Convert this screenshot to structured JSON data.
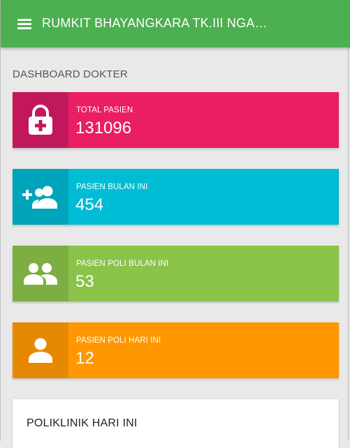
{
  "app": {
    "title": "RUMKIT BHAYANGKARA TK.III NGANJ..."
  },
  "dashboard": {
    "title": "DASHBOARD DOKTER"
  },
  "cards": [
    {
      "label": "TOTAL PASIEN",
      "value": "131096",
      "icon": "lock-plus-icon",
      "color": "#e91e63"
    },
    {
      "label": "PASIEN BULAN INI",
      "value": "454",
      "icon": "group-add-icon",
      "color": "#00bcd4"
    },
    {
      "label": "PASIEN POLI BULAN INI",
      "value": "53",
      "icon": "people-icon",
      "color": "#8bc34a"
    },
    {
      "label": "PASIEN POLI HARI INI",
      "value": "12",
      "icon": "person-icon",
      "color": "#ff9800"
    }
  ],
  "poliklinik": {
    "title": "POLIKLINIK HARI INI"
  }
}
